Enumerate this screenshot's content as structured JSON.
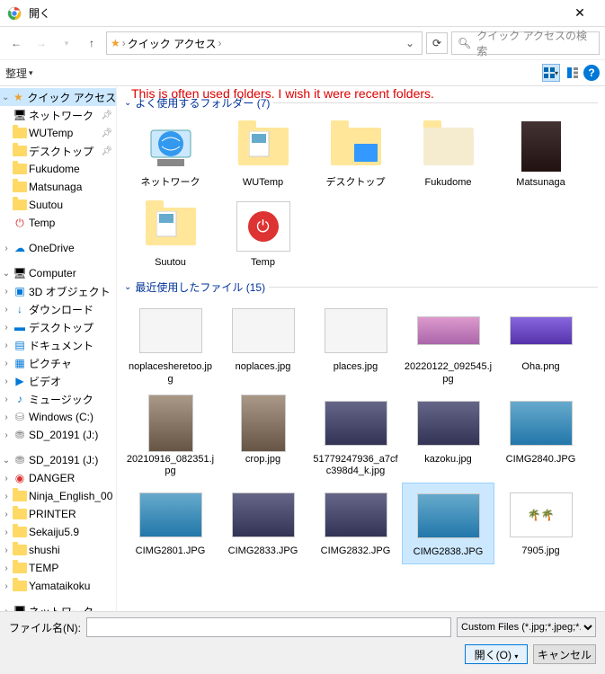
{
  "title_bar": {
    "title": "開く"
  },
  "nav": {
    "crumb1": "クイック アクセス",
    "search_placeholder": "クイック アクセスの検索"
  },
  "toolbar": {
    "organize": "整理"
  },
  "annotation": "This is often used folders. I wish it were recent folders.",
  "sidebar": {
    "quick_access": "クイック アクセス",
    "qa": {
      "network": "ネットワーク",
      "wutemp": "WUTemp",
      "desktop": "デスクトップ",
      "fukudome": "Fukudome",
      "matsunaga": "Matsunaga",
      "suutou": "Suutou",
      "temp": "Temp"
    },
    "onedrive": "OneDrive",
    "computer": "Computer",
    "pc": {
      "objects3d": "3D オブジェクト",
      "downloads": "ダウンロード",
      "desktop": "デスクトップ",
      "documents": "ドキュメント",
      "pictures": "ピクチャ",
      "videos": "ビデオ",
      "music": "ミュージック",
      "windows_c": "Windows (C:)",
      "sd_j": "SD_20191 (J:)"
    },
    "drive_j": "SD_20191 (J:)",
    "j": {
      "danger": "DANGER",
      "ninja": "Ninja_English_00",
      "printer": "PRINTER",
      "sekaiju": "Sekaiju5.9",
      "shushi": "shushi",
      "temp": "TEMP",
      "yamataikoku": "Yamataikoku"
    },
    "network_bottom": "ネットワーク"
  },
  "groups": {
    "frequent": "よく使用するフォルダー (7)",
    "recent": "最近使用したファイル (15)"
  },
  "folders": {
    "f0": "ネットワーク",
    "f1": "WUTemp",
    "f2": "デスクトップ",
    "f3": "Fukudome",
    "f4": "Matsunaga",
    "f5": "Suutou",
    "f6": "Temp"
  },
  "files": {
    "r0": "noplacesheretoo.jpg",
    "r1": "noplaces.jpg",
    "r2": "places.jpg",
    "r3": "20220122_092545.jpg",
    "r4": "Oha.png",
    "r5": "20210916_082351.jpg",
    "r6": "crop.jpg",
    "r7": "51779247936_a7cfc398d4_k.jpg",
    "r8": "kazoku.jpg",
    "r9": "CIMG2840.JPG",
    "r10": "CIMG2801.JPG",
    "r11": "CIMG2833.JPG",
    "r12": "CIMG2832.JPG",
    "r13": "CIMG2838.JPG",
    "r14": "7905.jpg"
  },
  "footer": {
    "filename_label": "ファイル名(N):",
    "filter": "Custom Files (*.jpg;*.jpeg;*.png",
    "open": "開く(O)",
    "cancel": "キャンセル"
  }
}
